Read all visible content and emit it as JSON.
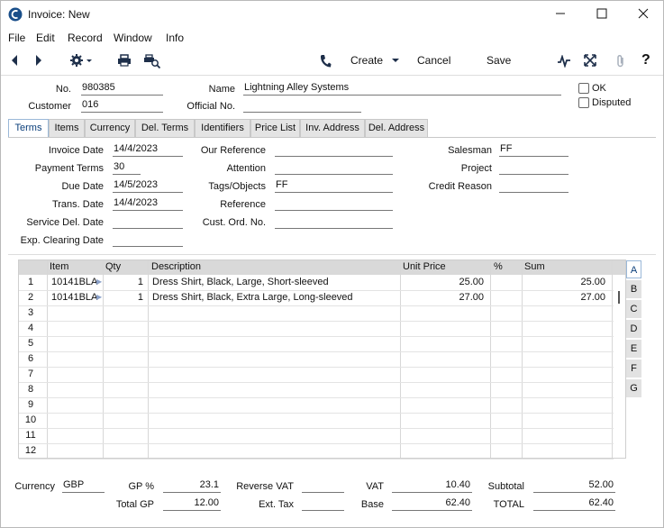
{
  "window": {
    "title": "Invoice: New",
    "minimize": "—",
    "maximize": "☐",
    "close": "✕"
  },
  "menu": [
    "File",
    "Edit",
    "Record",
    "Window",
    "Info"
  ],
  "toolbar": {
    "create": "Create",
    "cancel": "Cancel",
    "save": "Save",
    "help": "?"
  },
  "header": {
    "no_label": "No.",
    "no_value": "980385",
    "name_label": "Name",
    "name_value": "Lightning Alley Systems",
    "customer_label": "Customer",
    "customer_value": "016",
    "official_label": "Official No.",
    "official_value": "",
    "ok_label": "OK",
    "disputed_label": "Disputed"
  },
  "tabs": [
    "Terms",
    "Items",
    "Currency",
    "Del. Terms",
    "Identifiers",
    "Price List",
    "Inv. Address",
    "Del. Address"
  ],
  "terms": {
    "invoice_date_label": "Invoice Date",
    "invoice_date": "14/4/2023",
    "payment_terms_label": "Payment Terms",
    "payment_terms": "30",
    "due_date_label": "Due Date",
    "due_date": "14/5/2023",
    "trans_date_label": "Trans. Date",
    "trans_date": "14/4/2023",
    "service_del_label": "Service Del. Date",
    "service_del": "",
    "exp_clearing_label": "Exp. Clearing Date",
    "exp_clearing": "",
    "our_ref_label": "Our Reference",
    "our_ref": "",
    "attention_label": "Attention",
    "attention": "",
    "tags_label": "Tags/Objects",
    "tags": "FF",
    "reference_label": "Reference",
    "reference": "",
    "cust_ord_label": "Cust. Ord. No.",
    "cust_ord": "",
    "salesman_label": "Salesman",
    "salesman": "FF",
    "project_label": "Project",
    "project": "",
    "credit_reason_label": "Credit Reason",
    "credit_reason": ""
  },
  "grid": {
    "columns": [
      "Item",
      "Qty",
      "Description",
      "Unit Price",
      "%",
      "Sum"
    ],
    "rows": [
      {
        "n": "1",
        "item": "10141BLA",
        "qty": "1",
        "desc": "Dress Shirt, Black, Large, Short-sleeved",
        "price": "25.00",
        "pct": "",
        "sum": "25.00"
      },
      {
        "n": "2",
        "item": "10141BLA",
        "qty": "1",
        "desc": "Dress Shirt, Black, Extra Large, Long-sleeved",
        "price": "27.00",
        "pct": "",
        "sum": "27.00"
      },
      {
        "n": "3"
      },
      {
        "n": "4"
      },
      {
        "n": "5"
      },
      {
        "n": "6"
      },
      {
        "n": "7"
      },
      {
        "n": "8"
      },
      {
        "n": "9"
      },
      {
        "n": "10"
      },
      {
        "n": "11"
      },
      {
        "n": "12"
      }
    ],
    "side_tabs": [
      "A",
      "B",
      "C",
      "D",
      "E",
      "F",
      "G"
    ]
  },
  "footer": {
    "currency_label": "Currency",
    "currency": "GBP",
    "gp_pct_label": "GP %",
    "gp_pct": "23.1",
    "total_gp_label": "Total GP",
    "total_gp": "12.00",
    "reverse_vat_label": "Reverse VAT",
    "reverse_vat": "",
    "ext_tax_label": "Ext. Tax",
    "ext_tax": "",
    "vat_label": "VAT",
    "vat": "10.40",
    "base_label": "Base",
    "base": "62.40",
    "subtotal_label": "Subtotal",
    "subtotal": "52.00",
    "total_label": "TOTAL",
    "total": "62.40"
  }
}
